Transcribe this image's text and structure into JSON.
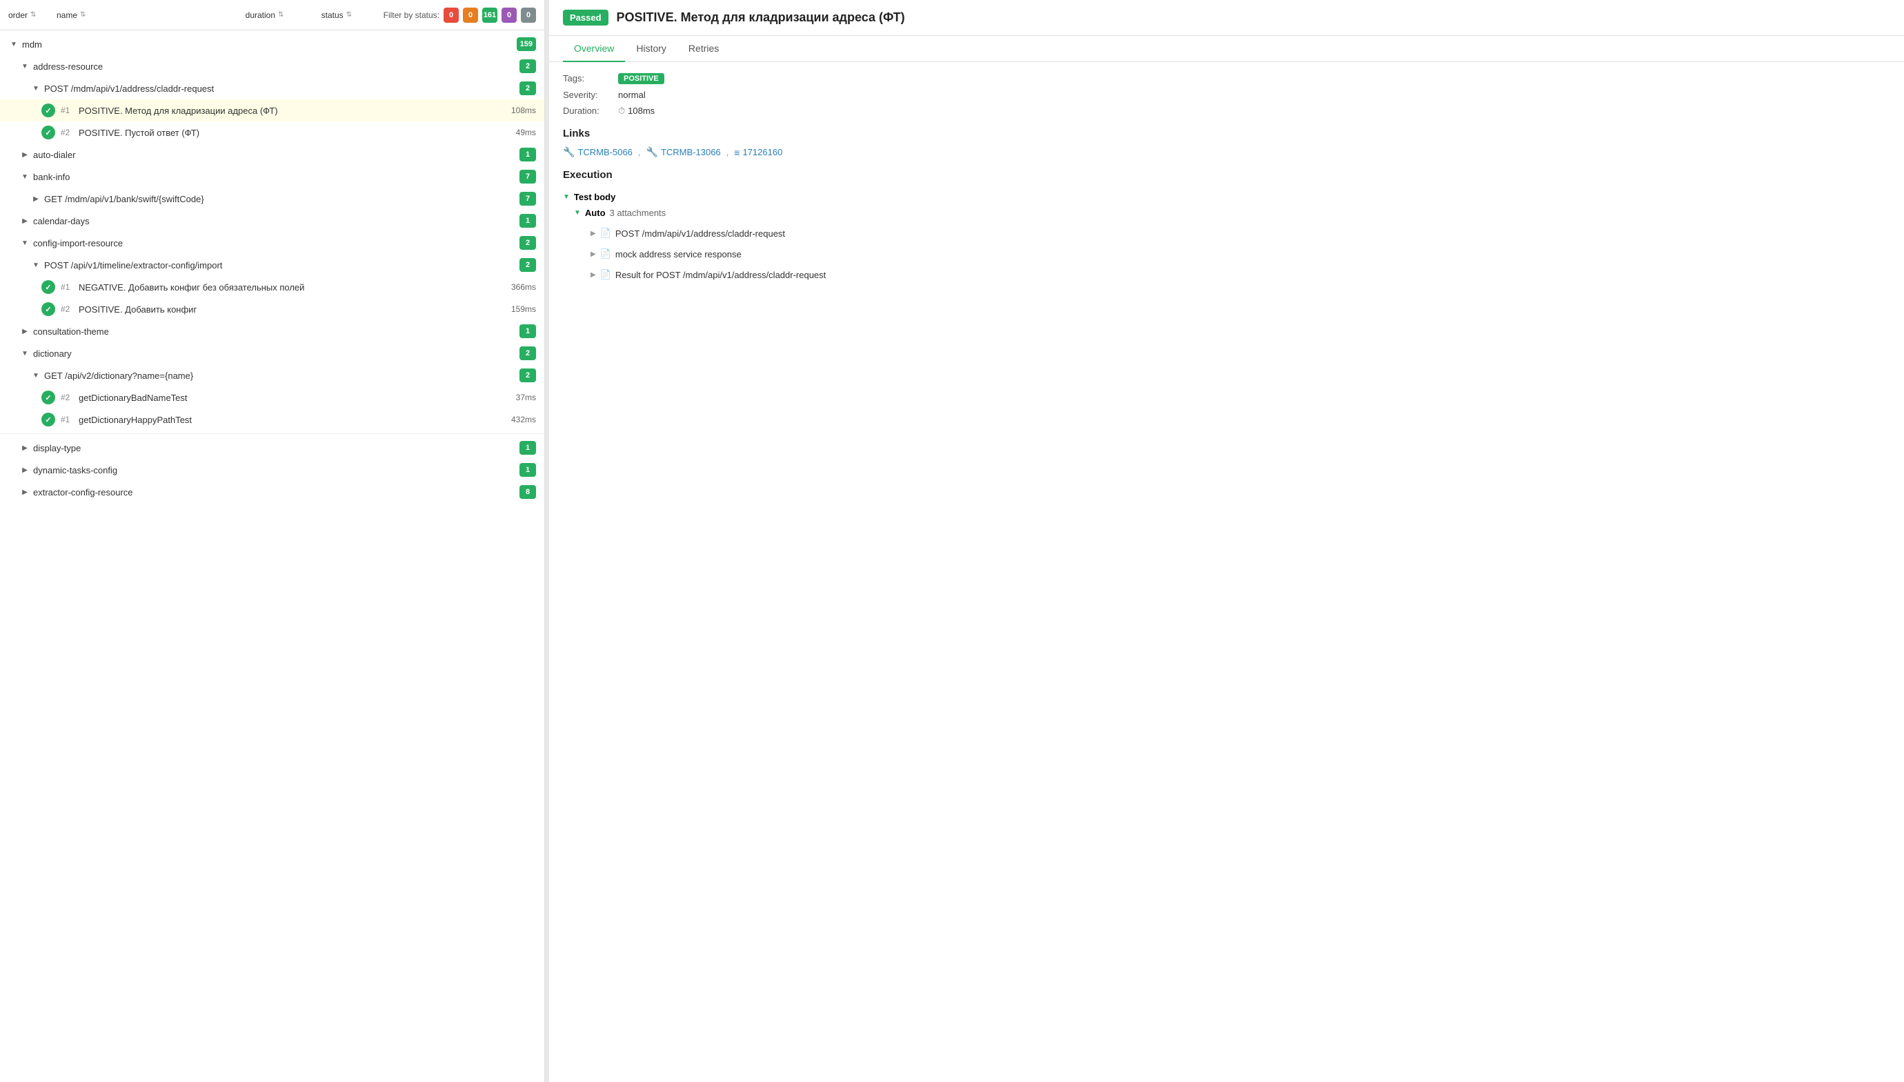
{
  "leftPanel": {
    "columns": {
      "order": "order",
      "name": "name",
      "duration": "duration",
      "status": "status"
    },
    "filterLabel": "Filter by status:",
    "filterBadges": [
      {
        "value": "0",
        "color": "red"
      },
      {
        "value": "0",
        "color": "orange"
      },
      {
        "value": "161",
        "color": "green"
      },
      {
        "value": "0",
        "color": "purple"
      },
      {
        "value": "0",
        "color": "dark"
      }
    ],
    "treeItems": [
      {
        "id": "mdm",
        "label": "mdm",
        "level": 0,
        "expanded": true,
        "count": "159",
        "type": "group"
      },
      {
        "id": "address-resource",
        "label": "address-resource",
        "level": 1,
        "expanded": true,
        "count": "2",
        "type": "group"
      },
      {
        "id": "post-address",
        "label": "POST /mdm/api/v1/address/claddr-request",
        "level": 2,
        "expanded": true,
        "count": "2",
        "type": "group"
      },
      {
        "id": "test1",
        "label": "#1  POSITIVE. Метод для кладризации адреса (ФТ)",
        "level": 3,
        "duration": "108ms",
        "type": "test",
        "highlighted": true,
        "number": "#1",
        "testLabel": "POSITIVE. Метод для кладризации адреса (ФТ)"
      },
      {
        "id": "test2",
        "label": "#2  POSITIVE. Пустой ответ (ФТ)",
        "level": 3,
        "duration": "49ms",
        "type": "test",
        "number": "#2",
        "testLabel": "POSITIVE. Пустой ответ (ФТ)"
      },
      {
        "id": "auto-dialer",
        "label": "auto-dialer",
        "level": 1,
        "count": "1",
        "type": "group"
      },
      {
        "id": "bank-info",
        "label": "bank-info",
        "level": 1,
        "expanded": true,
        "count": "7",
        "type": "group"
      },
      {
        "id": "get-bank",
        "label": "GET /mdm/api/v1/bank/swift/{swiftCode}",
        "level": 2,
        "count": "7",
        "type": "group"
      },
      {
        "id": "calendar-days",
        "label": "calendar-days",
        "level": 1,
        "count": "1",
        "type": "group"
      },
      {
        "id": "config-import-resource",
        "label": "config-import-resource",
        "level": 1,
        "expanded": true,
        "count": "2",
        "type": "group"
      },
      {
        "id": "post-timeline",
        "label": "POST /api/v1/timeline/extractor-config/import",
        "level": 2,
        "expanded": true,
        "count": "2",
        "type": "group"
      },
      {
        "id": "test-neg1",
        "label": "#1  NEGATIVE. Добавить конфиг без обязательных полей",
        "level": 3,
        "duration": "366ms",
        "type": "test",
        "number": "#1",
        "testLabel": "NEGATIVE. Добавить конфиг без обязательных полей"
      },
      {
        "id": "test-pos2",
        "label": "#2  POSITIVE. Добавить конфиг",
        "level": 3,
        "duration": "159ms",
        "type": "test",
        "number": "#2",
        "testLabel": "POSITIVE. Добавить конфиг"
      },
      {
        "id": "consultation-theme",
        "label": "consultation-theme",
        "level": 1,
        "count": "1",
        "type": "group"
      },
      {
        "id": "dictionary",
        "label": "dictionary",
        "level": 1,
        "expanded": true,
        "count": "2",
        "type": "group"
      },
      {
        "id": "get-dictionary",
        "label": "GET /api/v2/dictionary?name={name}",
        "level": 2,
        "expanded": true,
        "count": "2",
        "type": "group"
      },
      {
        "id": "test-dict1",
        "label": "#2  getDictionaryBadNameTest",
        "level": 3,
        "duration": "37ms",
        "type": "test",
        "number": "#2",
        "testLabel": "getDictionaryBadNameTest"
      },
      {
        "id": "test-dict2",
        "label": "#1  getDictionaryHappyPathTest",
        "level": 3,
        "duration": "432ms",
        "type": "test",
        "number": "#1",
        "testLabel": "getDictionaryHappyPathTest"
      },
      {
        "id": "display-type",
        "label": "display-type",
        "level": 1,
        "count": "1",
        "type": "group"
      },
      {
        "id": "dynamic-tasks-config",
        "label": "dynamic-tasks-config",
        "level": 1,
        "count": "1",
        "type": "group"
      },
      {
        "id": "extractor-config-resource",
        "label": "extractor-config-resource",
        "level": 1,
        "count": "8",
        "type": "group"
      }
    ]
  },
  "rightPanel": {
    "passedLabel": "Passed",
    "title": "POSITIVE. Метод для кладризации адреса (ФТ)",
    "tabs": [
      {
        "id": "overview",
        "label": "Overview",
        "active": true
      },
      {
        "id": "history",
        "label": "History",
        "active": false
      },
      {
        "id": "retries",
        "label": "Retries",
        "active": false
      }
    ],
    "tagsLabel": "Tags:",
    "tagValue": "POSITIVE",
    "severityLabel": "Severity:",
    "severityValue": "normal",
    "durationLabel": "Duration:",
    "durationValue": "108ms",
    "linksTitle": "Links",
    "links": [
      {
        "icon": "🔧",
        "label": "TCRMB-5066"
      },
      {
        "icon": "🔧",
        "label": "TCRMB-13066"
      },
      {
        "icon": "≡",
        "label": "17126160"
      }
    ],
    "executionTitle": "Execution",
    "testBodyLabel": "Test body",
    "autoLabel": "Auto",
    "attachmentsCount": "3 attachments",
    "attachments": [
      {
        "label": "POST /mdm/api/v1/address/claddr-request"
      },
      {
        "label": "mock address service response"
      },
      {
        "label": "Result for POST /mdm/api/v1/address/claddr-request"
      }
    ]
  }
}
